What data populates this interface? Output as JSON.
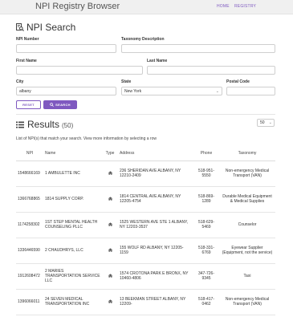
{
  "nav": {
    "brand": "NPI Registry Browser",
    "home": "HOME",
    "registry": "REGISTRY"
  },
  "search": {
    "title": "NPI Search",
    "npi_label": "NPI Number",
    "npi_value": "",
    "taxonomy_label": "Taxonomy Description",
    "taxonomy_value": "",
    "first_label": "First Name",
    "first_value": "",
    "last_label": "Last Name",
    "last_value": "",
    "city_label": "City",
    "city_value": "albany",
    "state_label": "State",
    "state_value": "New York",
    "postal_label": "Postal Code",
    "postal_value": "",
    "reset_label": "RESET",
    "search_label": "SEARCH"
  },
  "results": {
    "title": "Results",
    "count": "(50)",
    "page_size": "50",
    "description": "List of NPI(s) that match your search. View more information by selecting a row",
    "columns": {
      "npi": "NPI",
      "name": "Name",
      "type": "Type",
      "address": "Address",
      "phone": "Phone",
      "taxonomy": "Taxonomy"
    },
    "rows": [
      {
        "npi": "1548666169",
        "name": "1 AMBULETTE INC",
        "type": "organization",
        "address": "236 SHERIDAN AVE ALBANY, NY 12210-2409",
        "phone": "518-951-5550",
        "taxonomy": "Non-emergency Medical Transport (VAN)"
      },
      {
        "npi": "1366768865",
        "name": "1814 SUPPLY CORP.",
        "type": "organization",
        "address": "1814 CENTRAL AVE ALBANY, NY 12205-4754",
        "phone": "518-869-1289",
        "taxonomy": "Durable Medical Equipment & Medical Supplies"
      },
      {
        "npi": "1174258302",
        "name": "1ST STEP MENTAL HEALTH COUNSELING PLLC",
        "type": "organization",
        "address": "1525 WESTERN AVE STE 1 ALBANY, NY 12203-3537",
        "phone": "518-629-5469",
        "taxonomy": "Counselor"
      },
      {
        "npi": "1336446590",
        "name": "2 CHAUDHRYS, LLC",
        "type": "organization",
        "address": "155 WOLF RD ALBANY, NY 12205-1159",
        "phone": "518-331-6769",
        "taxonomy": "Eyewear Supplier (Equipment, not the service)"
      },
      {
        "npi": "1912608472",
        "name": "2 MARIES TRANSPORTATION SERVICE LLC",
        "type": "organization",
        "address": "1574 CROTONA PARK E BRONX, NY 10460-4806",
        "phone": "347-726-9345",
        "taxonomy": "Taxi"
      },
      {
        "npi": "1396066011",
        "name": "24 SEVEN MEDICAL TRANSPORTATION INC",
        "type": "organization",
        "address": "13 BEEKMAN STREET ALBANY, NY 12209-",
        "phone": "518-417-0462",
        "taxonomy": "Non-emergency Medical Transport (VAN)"
      }
    ]
  },
  "colors": {
    "accent": "#7f59c0",
    "navbar_bg": "#f0f0f0"
  },
  "icons": {
    "search_title": "magnifier-document-icon",
    "results_title": "list-icon",
    "search_button": "search-icon",
    "type": "building-icon"
  }
}
